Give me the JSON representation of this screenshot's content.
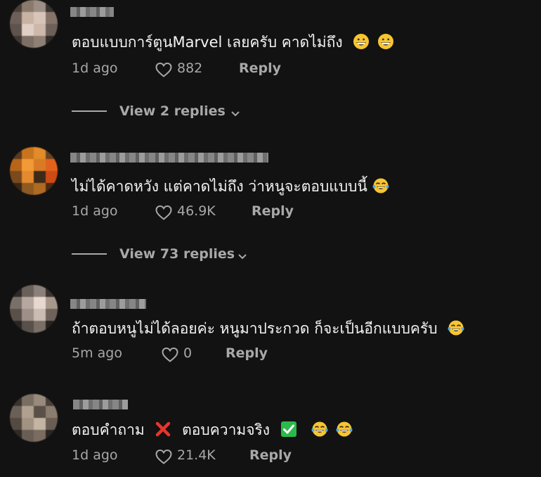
{
  "comments": [
    {
      "text": "ตอบแบบการ์ตูนMarvel เลยครับ คาดไม่ถึง",
      "emojis": [
        "grinning-face-icon",
        "grinning-face-icon"
      ],
      "time": "1d ago",
      "likes": "882",
      "reply_label": "Reply",
      "view_replies": "View 2 replies"
    },
    {
      "text": "ไม่ได้คาดหวัง แต่คาดไม่ถึง ว่าหนูจะตอบแบบนี้",
      "emojis": [
        "tears-of-joy-icon"
      ],
      "time": "1d ago",
      "likes": "46.9K",
      "reply_label": "Reply",
      "view_replies": "View 73 replies"
    },
    {
      "text": "ถ้าตอบหนูไม่ได้ลอยค่ะ หนูมาประกวด ก็จะเป็นอีกแบบครับ",
      "emojis": [
        "tears-of-joy-icon"
      ],
      "time": "5m ago",
      "likes": "0",
      "reply_label": "Reply"
    },
    {
      "text_a": "ตอบคำถาม",
      "text_b": "ตอบความจริง",
      "emojis": [
        "cross-mark-icon",
        "check-mark-icon",
        "tears-of-joy-icon",
        "tears-of-joy-icon"
      ],
      "time": "1d ago",
      "likes": "21.4K",
      "reply_label": "Reply"
    }
  ],
  "colors": {
    "background": "#121212",
    "text": "#f4f4f4",
    "muted": "#a8a8a8",
    "cross": "#e5352b",
    "check": "#2db84b"
  }
}
